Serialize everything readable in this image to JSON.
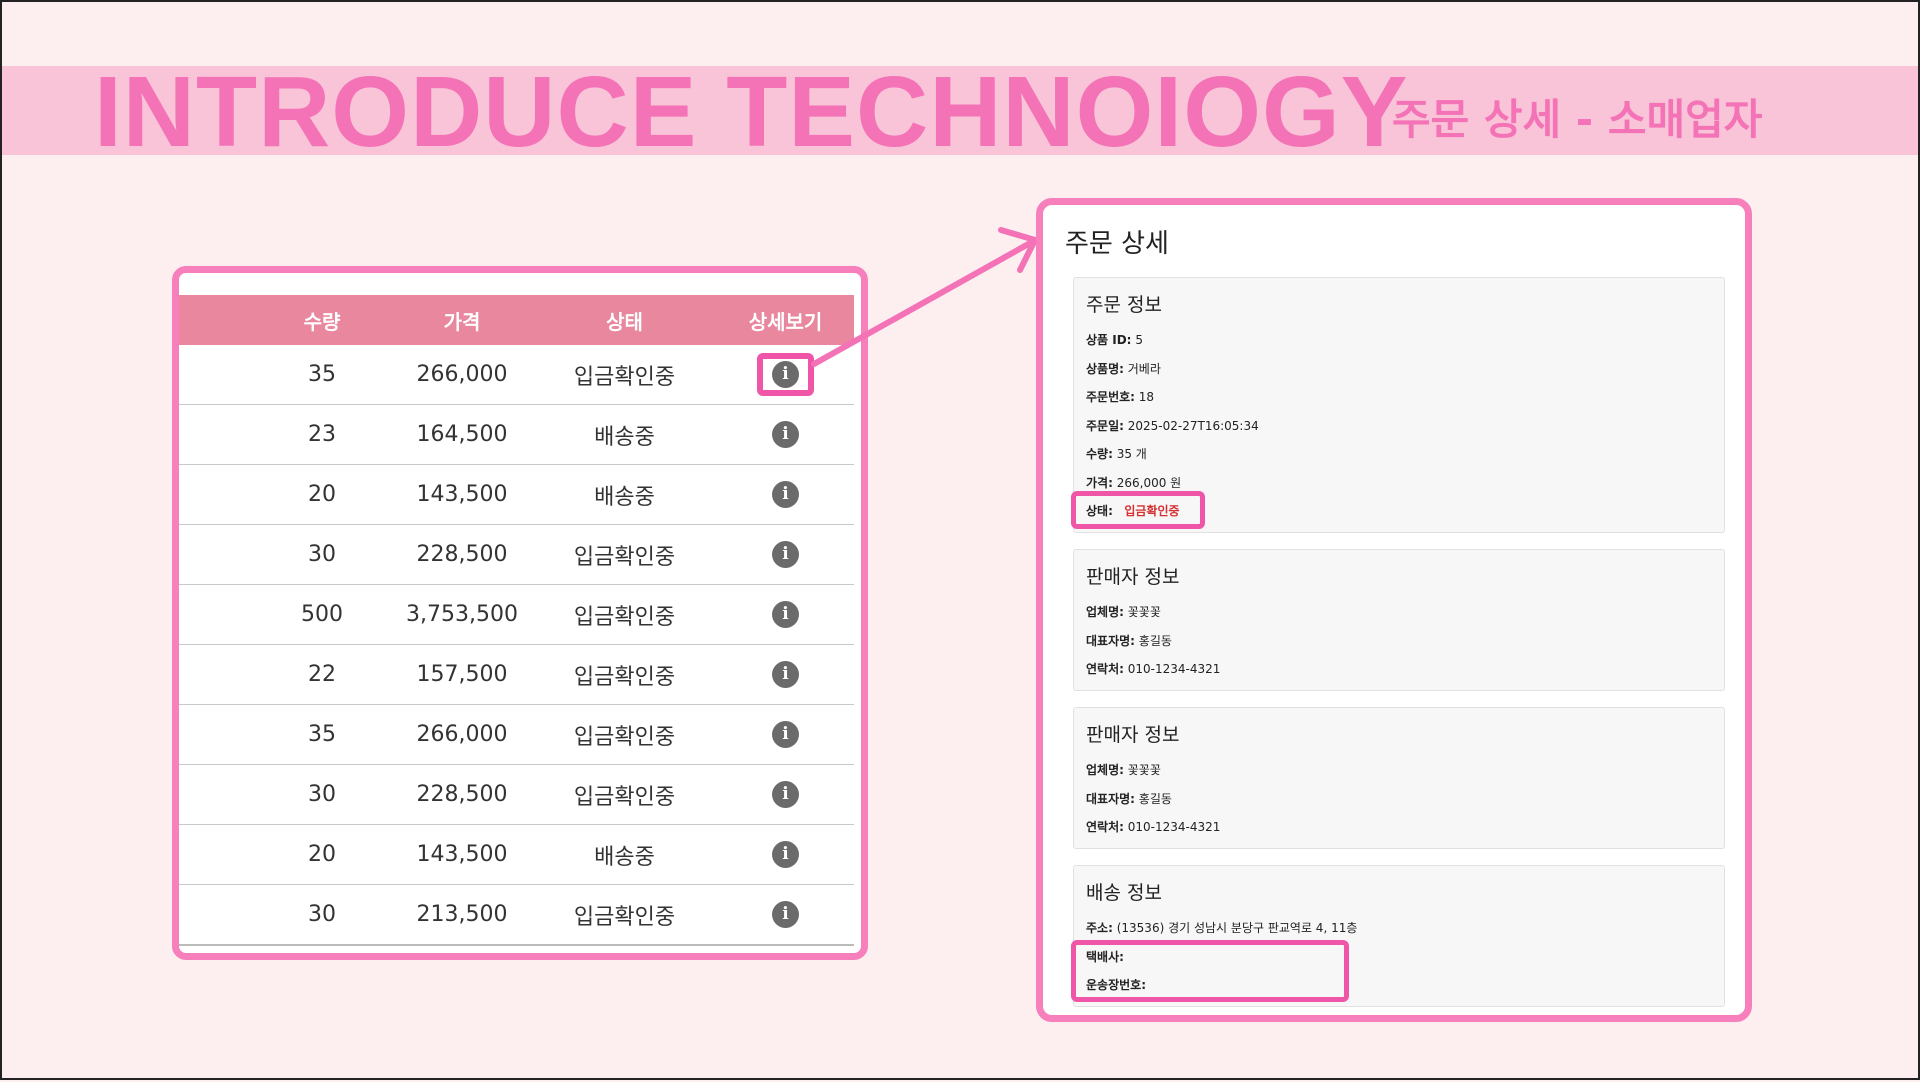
{
  "header": {
    "title": "INTRODUCE TECHNOIOGY",
    "subtitle": "주문 상세 - 소매업자"
  },
  "orders_table": {
    "columns": [
      "수량",
      "가격",
      "상태",
      "상세보기"
    ],
    "rows": [
      {
        "qty": "35",
        "price": "266,000",
        "status": "입금확인중",
        "status_type": "pending"
      },
      {
        "qty": "23",
        "price": "164,500",
        "status": "배송중",
        "status_type": "shipping"
      },
      {
        "qty": "20",
        "price": "143,500",
        "status": "배송중",
        "status_type": "shipping"
      },
      {
        "qty": "30",
        "price": "228,500",
        "status": "입금확인중",
        "status_type": "pending"
      },
      {
        "qty": "500",
        "price": "3,753,500",
        "status": "입금확인중",
        "status_type": "pending"
      },
      {
        "qty": "22",
        "price": "157,500",
        "status": "입금확인중",
        "status_type": "pending"
      },
      {
        "qty": "35",
        "price": "266,000",
        "status": "입금확인중",
        "status_type": "pending"
      },
      {
        "qty": "30",
        "price": "228,500",
        "status": "입금확인중",
        "status_type": "pending"
      },
      {
        "qty": "20",
        "price": "143,500",
        "status": "배송중",
        "status_type": "shipping"
      },
      {
        "qty": "30",
        "price": "213,500",
        "status": "입금확인중",
        "status_type": "pending"
      }
    ],
    "detail_icon": "info-icon",
    "detail_glyph": "i"
  },
  "detail": {
    "title": "주문 상세",
    "order_info": {
      "heading": "주문 정보",
      "product_id_label": "상품 ID:",
      "product_id": "5",
      "product_name_label": "상품명:",
      "product_name": "거베라",
      "order_no_label": "주문번호:",
      "order_no": "18",
      "order_date_label": "주문일:",
      "order_date": "2025-02-27T16:05:34",
      "qty_label": "수량:",
      "qty": "35 개",
      "price_label": "가격:",
      "price": "266,000 원",
      "status_label": "상태:",
      "status": "입금확인중"
    },
    "seller_info_1": {
      "heading": "판매자 정보",
      "company_label": "업체명:",
      "company": "꽃꽃꽃",
      "ceo_label": "대표자명:",
      "ceo": "홍길동",
      "contact_label": "연락처:",
      "contact": "010-1234-4321"
    },
    "seller_info_2": {
      "heading": "판매자 정보",
      "company_label": "업체명:",
      "company": "꽃꽃꽃",
      "ceo_label": "대표자명:",
      "ceo": "홍길동",
      "contact_label": "연락처:",
      "contact": "010-1234-4321"
    },
    "delivery_info": {
      "heading": "배송 정보",
      "address_label": "주소:",
      "address": "(13536) 경기 성남시 분당구 판교역로 4, 11층",
      "courier_label": "택배사:",
      "courier": "",
      "tracking_label": "운송장번호:",
      "tracking": ""
    }
  },
  "colors": {
    "accent_pink": "#f472b6",
    "header_band": "#f9c3d8",
    "table_header": "#e8879d",
    "status_pending": "#e53a3a",
    "status_shipping": "#3f8a3f",
    "highlight_border": "#f056a8"
  }
}
